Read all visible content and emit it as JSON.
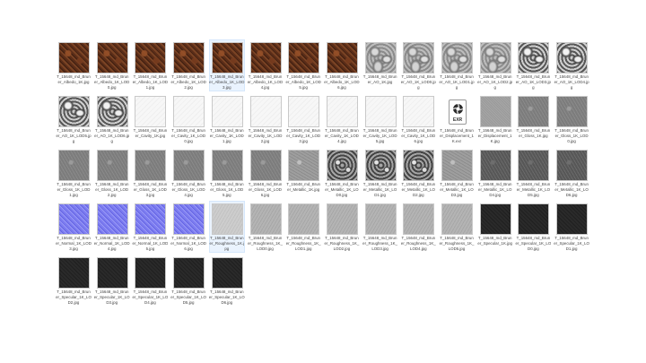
{
  "files": [
    {
      "name": "T_15648_md_Bruner_Albedo_1K.jpg",
      "kind": "albedo"
    },
    {
      "name": "T_15648_md_Bruner_Albedo_1K_LOD0.jpg",
      "kind": "albedo"
    },
    {
      "name": "T_15648_md_Bruner_Albedo_1K_LOD1.jpg",
      "kind": "albedo"
    },
    {
      "name": "T_15648_md_Bruner_Albedo_1K_LOD2.jpg",
      "kind": "albedo"
    },
    {
      "name": "T_15648_md_Bruner_Albedo_1K_LOD3.jpg",
      "kind": "albedo",
      "selected": true
    },
    {
      "name": "T_15648_md_Bruner_Albedo_1K_LOD4.jpg",
      "kind": "albedo"
    },
    {
      "name": "T_15648_md_Bruner_Albedo_1K_LOD5.jpg",
      "kind": "albedo"
    },
    {
      "name": "T_15648_md_Bruner_Albedo_1K_LOD6.jpg",
      "kind": "albedo"
    },
    {
      "name": "T_15648_md_Bruner_AO_1K.jpg",
      "kind": "ao"
    },
    {
      "name": "T_15648_md_Bruner_AO_1K_LOD0.jpg",
      "kind": "ao"
    },
    {
      "name": "T_15648_md_Bruner_AO_1K_LOD1.jpg",
      "kind": "ao"
    },
    {
      "name": "T_15648_md_Bruner_AO_1K_LOD2.jpg",
      "kind": "ao"
    },
    {
      "name": "T_15648_md_Bruner_AO_1K_LOD3.jpg",
      "kind": "ao-dark"
    },
    {
      "name": "T_15648_md_Bruner_AO_1K_LOD4.jpg",
      "kind": "ao-dark"
    },
    {
      "name": "T_15648_md_Bruner_AO_1K_LOD5.jpg",
      "kind": "ao-dark"
    },
    {
      "name": "T_15648_md_Bruner_AO_1K_LOD6.jpg",
      "kind": "ao-dark"
    },
    {
      "name": "T_15648_md_Bruner_Cavity_1K.jpg",
      "kind": "cavity"
    },
    {
      "name": "T_15648_md_Bruner_Cavity_1K_LOD0.jpg",
      "kind": "cavity"
    },
    {
      "name": "T_15648_md_Bruner_Cavity_1K_LOD1.jpg",
      "kind": "cavity"
    },
    {
      "name": "T_15648_md_Bruner_Cavity_1K_LOD2.jpg",
      "kind": "cavity"
    },
    {
      "name": "T_15648_md_Bruner_Cavity_1K_LOD3.jpg",
      "kind": "cavity"
    },
    {
      "name": "T_15648_md_Bruner_Cavity_1K_LOD4.jpg",
      "kind": "cavity"
    },
    {
      "name": "T_15648_md_Bruner_Cavity_1K_LOD5.jpg",
      "kind": "cavity"
    },
    {
      "name": "T_15648_md_Bruner_Cavity_1K_LOD6.jpg",
      "kind": "cavity"
    },
    {
      "name": "T_15648_md_Bruner_Displacement_1K.exr",
      "kind": "exr"
    },
    {
      "name": "T_15648_md_Bruner_Displacement_1K.jpg",
      "kind": "displace"
    },
    {
      "name": "T_15648_md_Bruner_Gloss_1K.jpg",
      "kind": "gloss"
    },
    {
      "name": "T_15648_md_Bruner_Gloss_1K_LOD0.jpg",
      "kind": "gloss"
    },
    {
      "name": "T_15648_md_Bruner_Gloss_1K_LOD1.jpg",
      "kind": "gloss"
    },
    {
      "name": "T_15648_md_Bruner_Gloss_1K_LOD2.jpg",
      "kind": "gloss"
    },
    {
      "name": "T_15648_md_Bruner_Gloss_1K_LOD3.jpg",
      "kind": "gloss"
    },
    {
      "name": "T_15648_md_Bruner_Gloss_1K_LOD4.jpg",
      "kind": "gloss"
    },
    {
      "name": "T_15648_md_Bruner_Gloss_1K_LOD5.jpg",
      "kind": "gloss"
    },
    {
      "name": "T_15648_md_Bruner_Gloss_1K_LOD6.jpg",
      "kind": "gloss"
    },
    {
      "name": "T_15648_md_Bruner_Metallic_1K.jpg",
      "kind": "metallic"
    },
    {
      "name": "T_15648_md_Bruner_Metallic_1K_LOD0.jpg",
      "kind": "metallic-dark"
    },
    {
      "name": "T_15648_md_Bruner_Metallic_1K_LOD1.jpg",
      "kind": "metallic-dark"
    },
    {
      "name": "T_15648_md_Bruner_Metallic_1K_LOD2.jpg",
      "kind": "metallic-dark"
    },
    {
      "name": "T_15648_md_Bruner_Metallic_1K_LOD3.jpg",
      "kind": "metallic"
    },
    {
      "name": "T_15648_md_Bruner_Metallic_1K_LOD4.jpg",
      "kind": "gloss-dark"
    },
    {
      "name": "T_15648_md_Bruner_Metallic_1K_LOD5.jpg",
      "kind": "gloss-dark"
    },
    {
      "name": "T_15648_md_Bruner_Metallic_1K_LOD6.jpg",
      "kind": "gloss-dark"
    },
    {
      "name": "T_15648_md_Bruner_Normal_1K_LOD3.jpg",
      "kind": "normal"
    },
    {
      "name": "T_15648_md_Bruner_Normal_1K_LOD4.jpg",
      "kind": "normal"
    },
    {
      "name": "T_15648_md_Bruner_Normal_1K_LOD5.jpg",
      "kind": "normal"
    },
    {
      "name": "T_15648_md_Bruner_Normal_1K_LOD6.jpg",
      "kind": "normal"
    },
    {
      "name": "T_15648_md_Bruner_Roughness_1K.jpg",
      "kind": "rough-light",
      "selected": true
    },
    {
      "name": "T_15648_md_Bruner_Roughness_1K_LOD0.jpg",
      "kind": "rough"
    },
    {
      "name": "T_15648_md_Bruner_Roughness_1K_LOD1.jpg",
      "kind": "rough"
    },
    {
      "name": "T_15648_md_Bruner_Roughness_1K_LOD2.jpg",
      "kind": "rough"
    },
    {
      "name": "T_15648_md_Bruner_Roughness_1K_LOD3.jpg",
      "kind": "rough"
    },
    {
      "name": "T_15648_md_Bruner_Roughness_1K_LOD4.jpg",
      "kind": "rough"
    },
    {
      "name": "T_15648_md_Bruner_Roughness_1K_LOD5.jpg",
      "kind": "rough"
    },
    {
      "name": "T_15648_md_Bruner_Specular_1K.jpg",
      "kind": "specular"
    },
    {
      "name": "T_15648_md_Bruner_Specular_1K_LOD0.jpg",
      "kind": "specular"
    },
    {
      "name": "T_15648_md_Bruner_Specular_1K_LOD1.jpg",
      "kind": "specular"
    },
    {
      "name": "T_15648_md_Bruner_Specular_1K_LOD2.jpg",
      "kind": "specular"
    },
    {
      "name": "T_15648_md_Bruner_Specular_1K_LOD3.jpg",
      "kind": "specular"
    },
    {
      "name": "T_15648_md_Bruner_Specular_1K_LOD4.jpg",
      "kind": "specular"
    },
    {
      "name": "T_15648_md_Bruner_Specular_1K_LOD5.jpg",
      "kind": "specular"
    },
    {
      "name": "T_15648_md_Bruner_Specular_1K_LOD6.jpg",
      "kind": "specular"
    }
  ],
  "exr_badge": "EXR",
  "colors": {
    "selection_bg": "#eaf3fe",
    "selection_border": "#d5e7fb",
    "background": "#ffffff"
  }
}
